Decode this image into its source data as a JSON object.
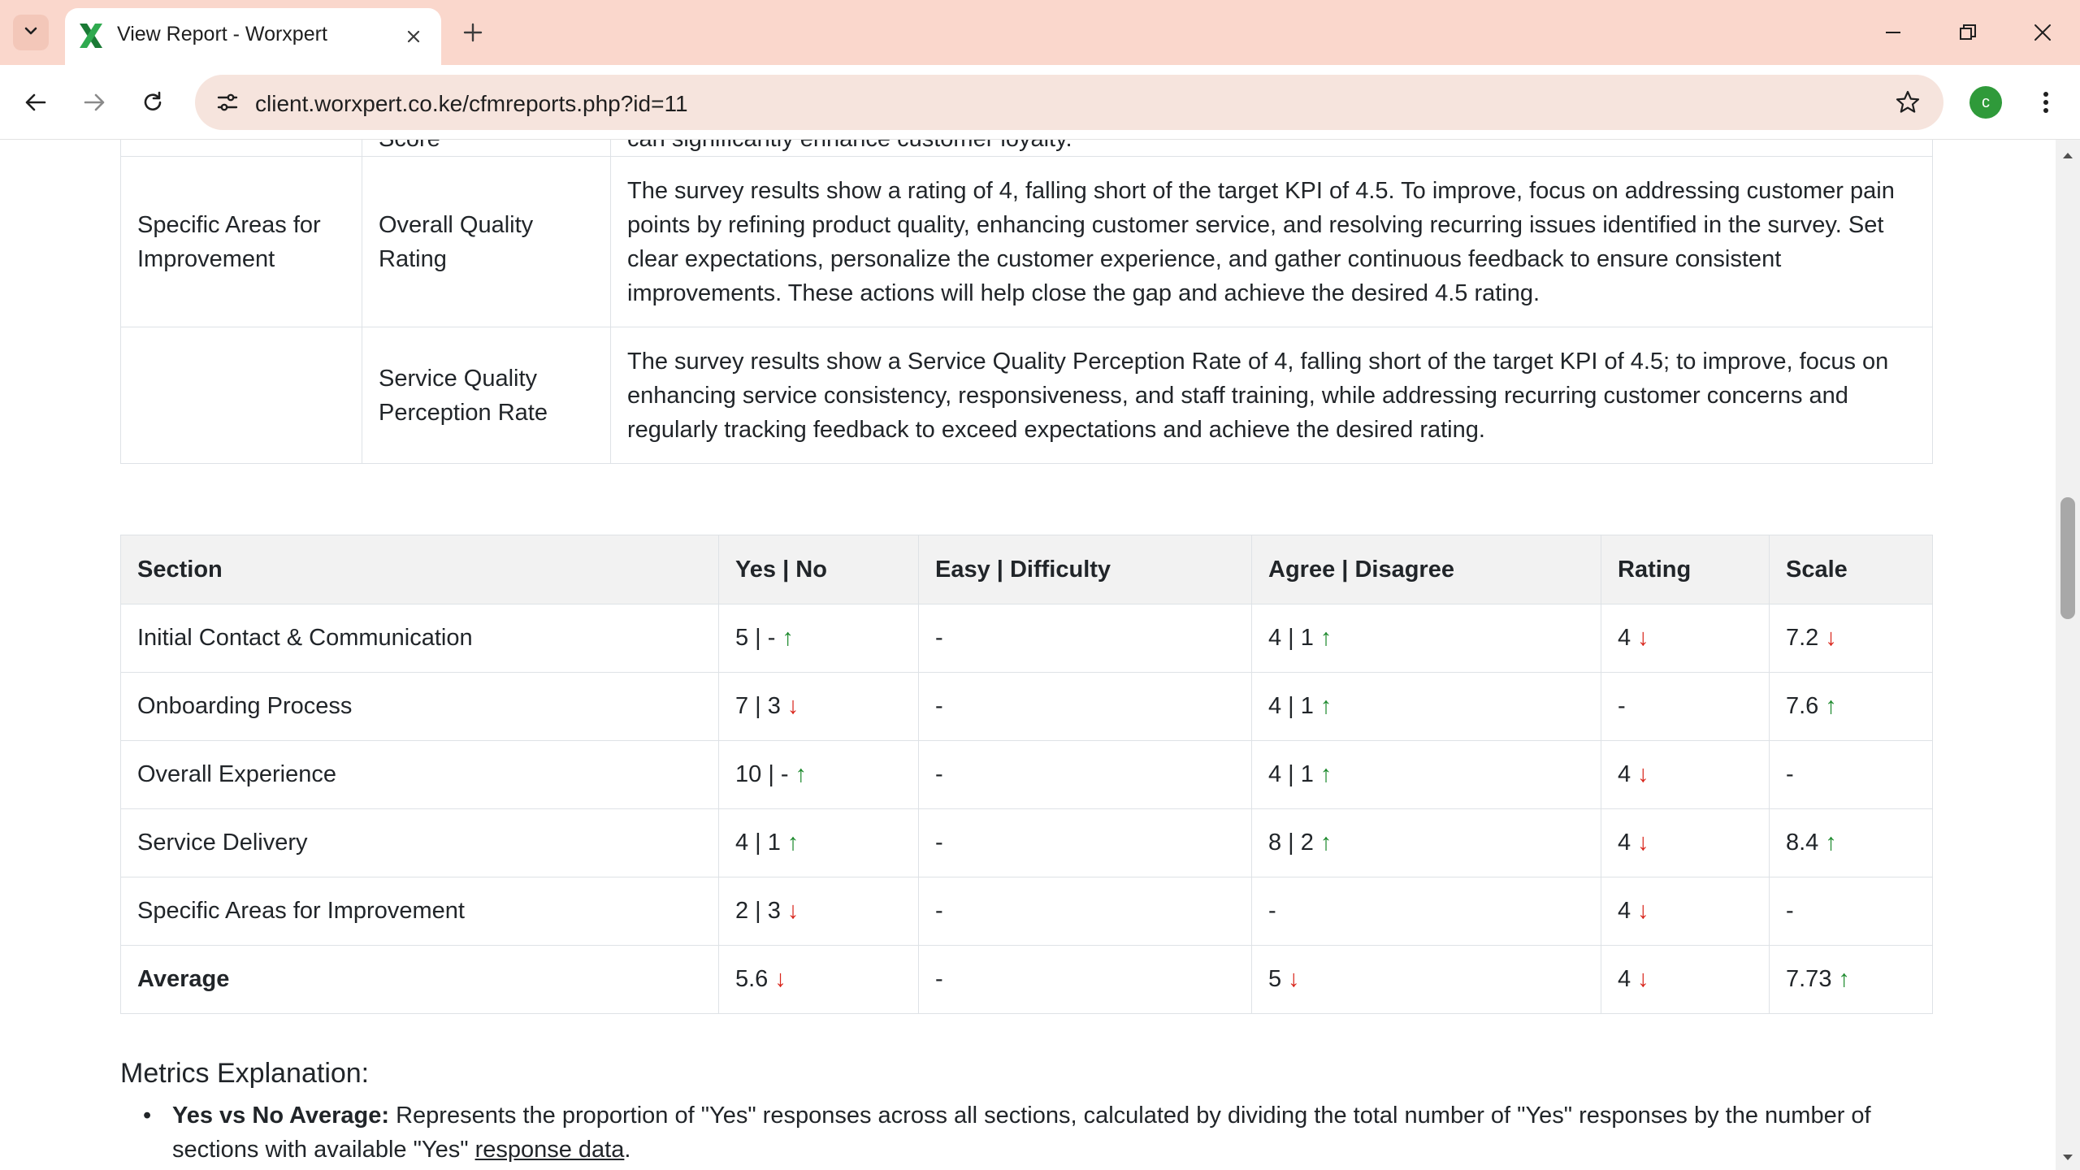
{
  "browser": {
    "tab_title": "View Report - Worxpert",
    "url": "client.worxpert.co.ke/cfmreports.php?id=11",
    "profile_initial": "c",
    "accent_color": "#fad7cc"
  },
  "analysis_table": {
    "rows": [
      {
        "area": "",
        "metric": "Score",
        "recommendation": "can significantly enhance customer loyalty."
      },
      {
        "area": "Specific Areas for Improvement",
        "metric": "Overall Quality Rating",
        "recommendation": "The survey results show a rating of 4, falling short of the target KPI of 4.5. To improve, focus on addressing customer pain points by refining product quality, enhancing customer service, and resolving recurring issues identified in the survey. Set clear expectations, personalize the customer experience, and gather continuous feedback to ensure consistent improvements. These actions will help close the gap and achieve the desired 4.5 rating."
      },
      {
        "area": "",
        "metric": "Service Quality Perception Rate",
        "recommendation": "The survey results show a Service Quality Perception Rate of 4, falling short of the target KPI of 4.5; to improve, focus on enhancing service consistency, responsiveness, and staff training, while addressing recurring customer concerns and regularly tracking feedback to exceed expectations and achieve the desired rating."
      }
    ]
  },
  "metrics_table": {
    "headers": {
      "section": "Section",
      "yes": "Yes",
      "no": "No",
      "easy": "Easy",
      "difficulty": "Difficulty",
      "agree": "Agree",
      "disagree": "Disagree",
      "rating": "Rating",
      "scale": "Scale",
      "separator": "|"
    },
    "arrows": {
      "up": "↑",
      "down": "↓"
    },
    "rows": [
      {
        "section": "Initial Contact & Communication",
        "yes_no": "5 | -",
        "yes_no_trend": "up",
        "easy_difficulty": "-",
        "agree_disagree": "4 | 1",
        "agree_trend": "up",
        "rating": "4",
        "rating_trend": "down",
        "scale": "7.2",
        "scale_trend": "down"
      },
      {
        "section": "Onboarding Process",
        "yes_no": "7 | 3",
        "yes_no_trend": "down",
        "easy_difficulty": "-",
        "agree_disagree": "4 | 1",
        "agree_trend": "up",
        "rating": "-",
        "rating_trend": "",
        "scale": "7.6",
        "scale_trend": "up"
      },
      {
        "section": "Overall Experience",
        "yes_no": "10 | -",
        "yes_no_trend": "up",
        "easy_difficulty": "-",
        "agree_disagree": "4 | 1",
        "agree_trend": "up",
        "rating": "4",
        "rating_trend": "down",
        "scale": "-",
        "scale_trend": ""
      },
      {
        "section": "Service Delivery",
        "yes_no": "4 | 1",
        "yes_no_trend": "up",
        "easy_difficulty": "-",
        "agree_disagree": "8 | 2",
        "agree_trend": "up",
        "rating": "4",
        "rating_trend": "down",
        "scale": "8.4",
        "scale_trend": "up"
      },
      {
        "section": "Specific Areas for Improvement",
        "yes_no": "2 | 3",
        "yes_no_trend": "down",
        "easy_difficulty": "-",
        "agree_disagree": "-",
        "agree_trend": "",
        "rating": "4",
        "rating_trend": "down",
        "scale": "-",
        "scale_trend": ""
      },
      {
        "section": "Average",
        "yes_no": "5.6",
        "yes_no_trend": "down",
        "easy_difficulty": "-",
        "agree_disagree": "5",
        "agree_trend": "down",
        "rating": "4",
        "rating_trend": "down",
        "scale": "7.73",
        "scale_trend": "up"
      }
    ],
    "trend_colors": {
      "up": "#1e8a2e",
      "down": "#d9261c"
    }
  },
  "explanation": {
    "heading": "Metrics Explanation:",
    "items": [
      {
        "term": "Yes vs No Average:",
        "text_before": " Represents the proportion of \"Yes\" responses across all sections, calculated by dividing the total number of \"Yes\" responses by the number of sections with available \"Yes\" ",
        "underlined": "response data",
        "text_after": "."
      }
    ]
  }
}
